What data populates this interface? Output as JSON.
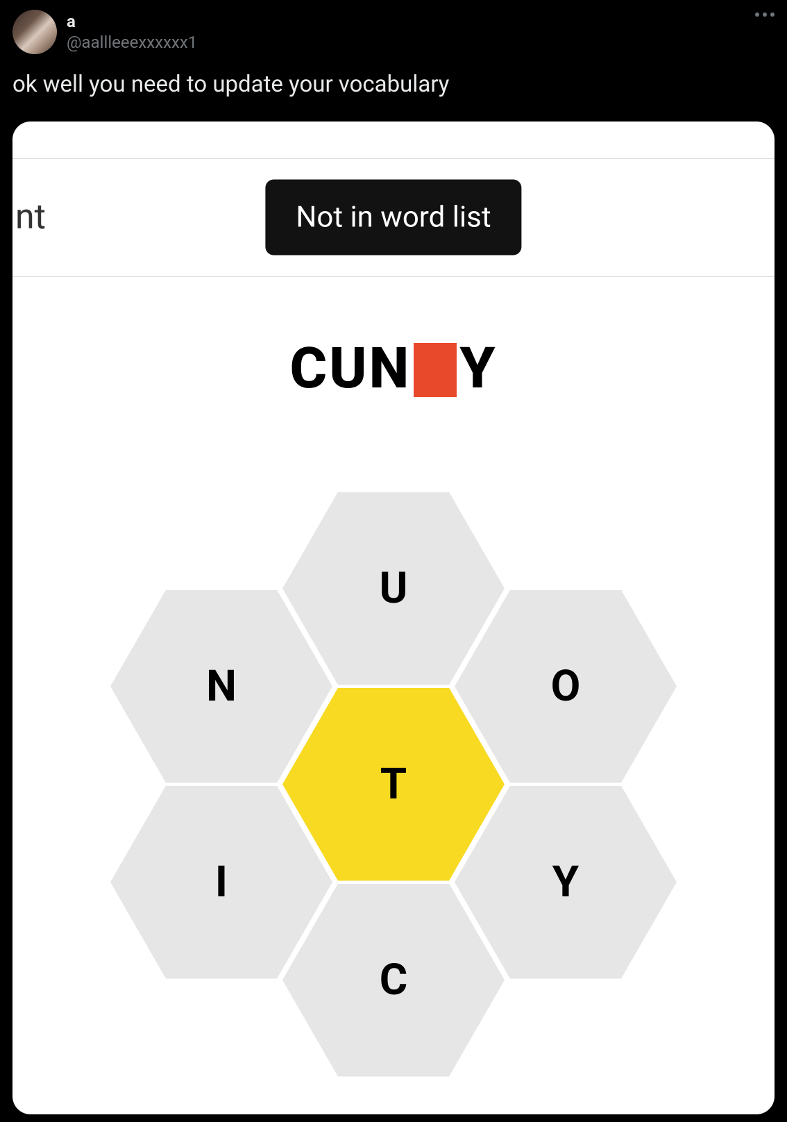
{
  "tweet": {
    "display_name": "a",
    "handle": "@aallleeexxxxxx1",
    "text": "ok well you need to update your vocabulary"
  },
  "game": {
    "left_fragment": "nt",
    "toast_message": "Not in word list",
    "current_word": {
      "prefix": "CUN",
      "suffix": "Y"
    },
    "hive": {
      "center": "T",
      "top": "U",
      "top_left": "N",
      "top_right": "O",
      "bottom_left": "I",
      "bottom_right": "Y",
      "bottom": "C"
    }
  },
  "colors": {
    "hex_outer": "#e6e6e6",
    "hex_center": "#f7da21",
    "cursor": "#e8492a"
  }
}
